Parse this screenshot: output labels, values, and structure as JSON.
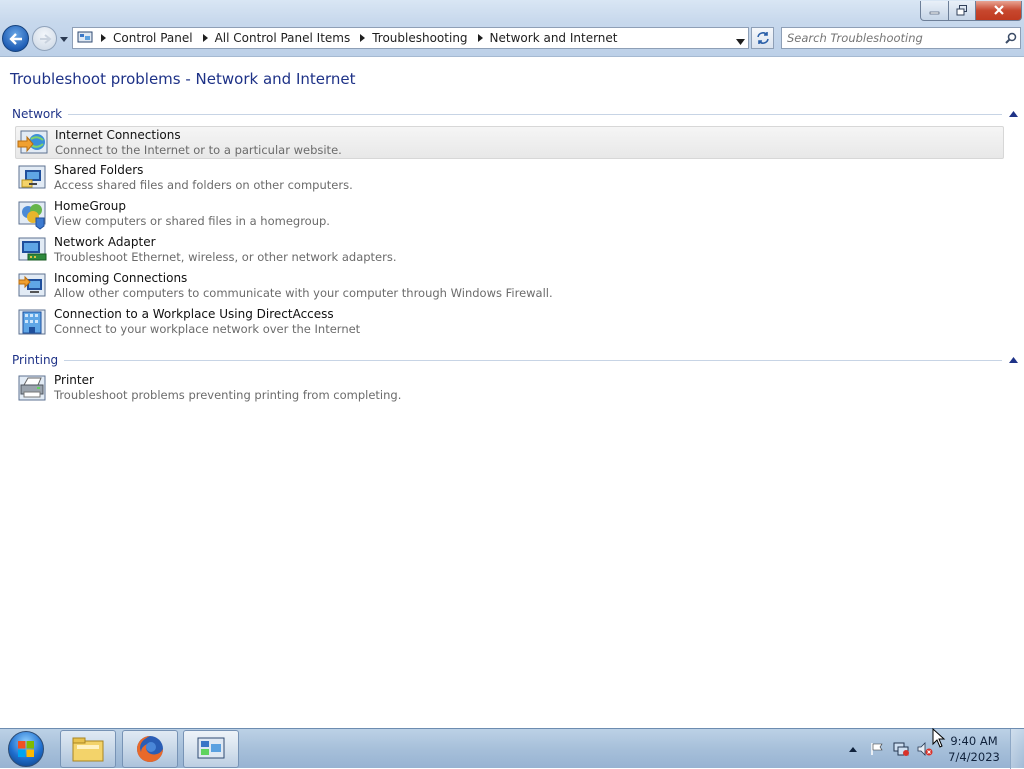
{
  "window": {
    "caption_buttons": {
      "minimize": "minimize-icon",
      "restore": "restore-icon",
      "close": "close-icon"
    }
  },
  "nav": {
    "back": "back-arrow-icon",
    "forward": "forward-arrow-icon",
    "breadcrumb": [
      "Control Panel",
      "All Control Panel Items",
      "Troubleshooting",
      "Network and Internet"
    ],
    "search_placeholder": "Search Troubleshooting"
  },
  "page": {
    "title": "Troubleshoot problems - Network and Internet"
  },
  "groups": [
    {
      "title": "Network",
      "items": [
        {
          "name": "Internet Connections",
          "desc": "Connect to the Internet or to a particular website.",
          "icon": "internet-connections-icon"
        },
        {
          "name": "Shared Folders",
          "desc": "Access shared files and folders on other computers.",
          "icon": "shared-folders-icon"
        },
        {
          "name": "HomeGroup",
          "desc": "View computers or shared files in a homegroup.",
          "icon": "homegroup-icon"
        },
        {
          "name": "Network Adapter",
          "desc": "Troubleshoot Ethernet, wireless, or other network adapters.",
          "icon": "network-adapter-icon"
        },
        {
          "name": "Incoming Connections",
          "desc": "Allow other computers to communicate with your computer through Windows Firewall.",
          "icon": "incoming-connections-icon"
        },
        {
          "name": "Connection to a Workplace Using DirectAccess",
          "desc": "Connect to your workplace network over the Internet",
          "icon": "directaccess-icon"
        }
      ]
    },
    {
      "title": "Printing",
      "items": [
        {
          "name": "Printer",
          "desc": "Troubleshoot problems preventing printing from completing.",
          "icon": "printer-icon"
        }
      ]
    }
  ],
  "taskbar": {
    "pinned": [
      "file-explorer-icon",
      "firefox-icon",
      "control-panel-icon"
    ],
    "tray": [
      "show-hidden-icons",
      "action-center-flag-icon",
      "network-icon",
      "volume-muted-icon"
    ],
    "time": "9:40 AM",
    "date": "7/4/2023"
  },
  "colors": {
    "heading": "#1e3287",
    "desc": "#6b6b6b",
    "accent": "#1f5eb6"
  }
}
